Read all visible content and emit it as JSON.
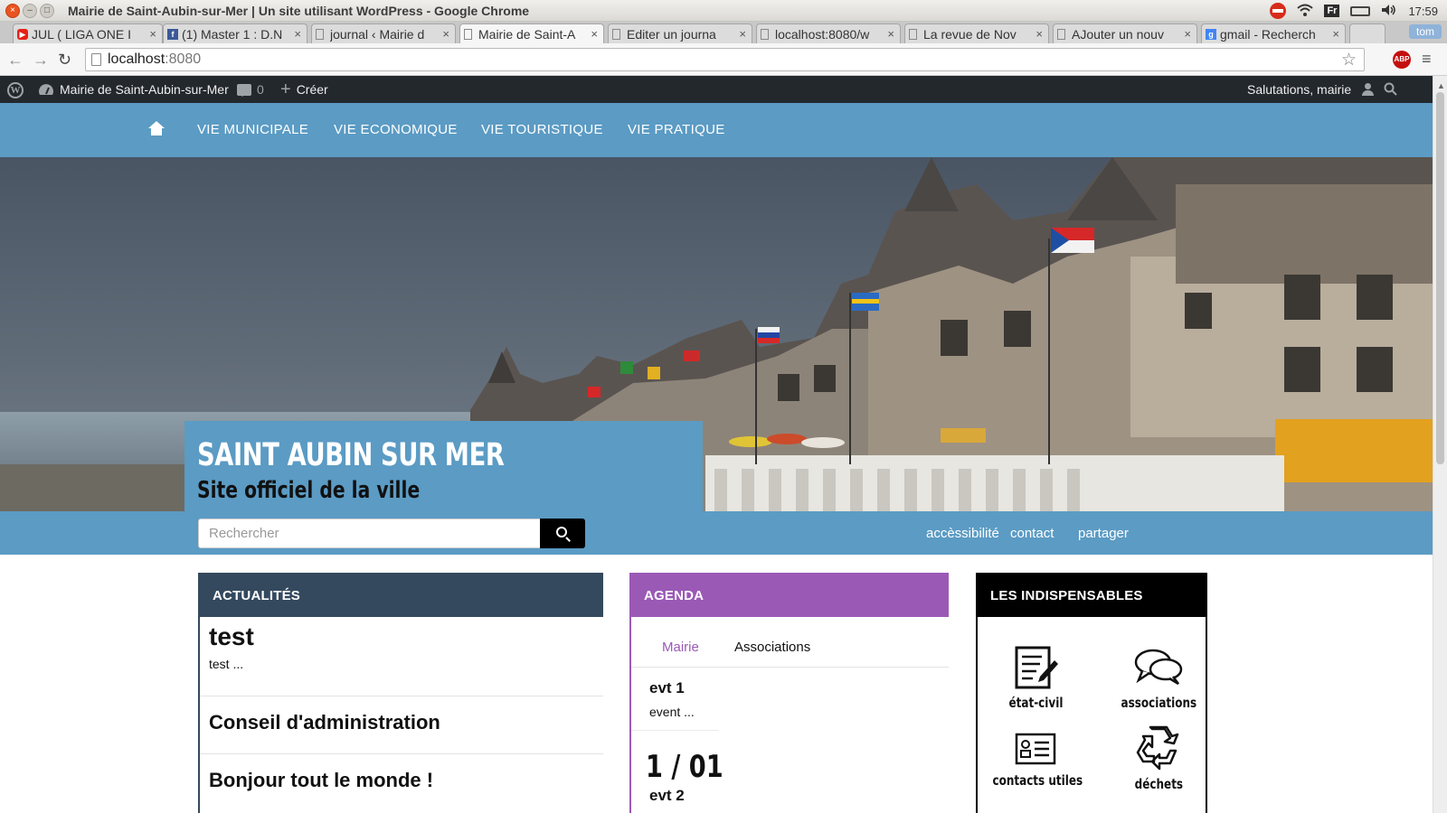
{
  "window": {
    "title": "Mairie de Saint-Aubin-sur-Mer | Un site utilisant WordPress - Google Chrome",
    "keyboard_layout": "Fr",
    "clock": "17:59"
  },
  "tabs": [
    {
      "label": "JUL ( LIGA ONE I",
      "icon": "youtube-icon"
    },
    {
      "label": "(1) Master 1 : D.N",
      "icon": "facebook-icon"
    },
    {
      "label": "journal ‹ Mairie d",
      "icon": "page-icon"
    },
    {
      "label": "Mairie de Saint-A",
      "icon": "page-icon",
      "active": true
    },
    {
      "label": "Editer un journa",
      "icon": "page-icon"
    },
    {
      "label": "localhost:8080/w",
      "icon": "page-icon"
    },
    {
      "label": "La revue de Nov",
      "icon": "page-icon"
    },
    {
      "label": "AJouter un nouv",
      "icon": "page-icon"
    },
    {
      "label": "gmail - Recherch",
      "icon": "google-icon"
    }
  ],
  "profile_name": "tom",
  "address_bar": {
    "host": "localhost",
    "port": ":8080"
  },
  "extension": {
    "abp_label": "ABP"
  },
  "admin_bar": {
    "site_name": "Mairie de Saint-Aubin-sur-Mer",
    "comments_count": "0",
    "create_label": "Créer",
    "greeting": "Salutations, mairie"
  },
  "nav": {
    "items": [
      "VIE MUNICIPALE",
      "VIE ECONOMIQUE",
      "VIE TOURISTIQUE",
      "VIE PRATIQUE"
    ]
  },
  "hero": {
    "title": "SAINT AUBIN SUR MER",
    "subtitle": "Site officiel de la ville"
  },
  "search": {
    "placeholder": "Rechercher"
  },
  "band_links": {
    "accessibility": "accèssibilité",
    "contact": "contact",
    "share": "partager"
  },
  "news": {
    "heading": "ACTUALITÉS",
    "items": [
      {
        "title": "test",
        "excerpt": "test ..."
      },
      {
        "title": "Conseil d'administration",
        "excerpt": ""
      },
      {
        "title": "Bonjour tout le monde !",
        "excerpt": ""
      }
    ]
  },
  "agenda": {
    "heading": "AGENDA",
    "tabs": [
      "Mairie",
      "Associations"
    ],
    "events": [
      {
        "title": "evt 1",
        "desc": "event ..."
      }
    ],
    "date": "1 / 01",
    "next_event": "evt 2"
  },
  "indispensables": {
    "heading": "LES INDISPENSABLES",
    "items": [
      {
        "label": "état-civil",
        "icon": "document-pen-icon"
      },
      {
        "label": "associations",
        "icon": "speech-bubbles-icon"
      },
      {
        "label": "contacts utiles",
        "icon": "contact-card-icon"
      },
      {
        "label": "déchets",
        "icon": "recycle-icon"
      }
    ]
  },
  "colors": {
    "brand_blue": "#5b9bc4",
    "news_navy": "#34495e",
    "agenda_purple": "#9b59b6",
    "admin_bar": "#23282d"
  }
}
